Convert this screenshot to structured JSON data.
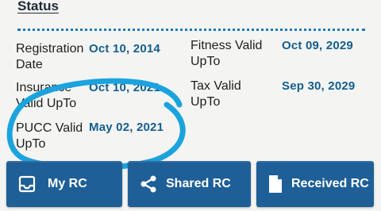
{
  "section": {
    "title": "Status"
  },
  "fields": [
    {
      "label_line1": "Registration",
      "label_line2": "Date",
      "value": "Oct 10, 2014"
    },
    {
      "label_line1": "Fitness Valid",
      "label_line2": "UpTo",
      "value": "Oct 09, 2029"
    },
    {
      "label_line1": "Insurance",
      "label_line2": "Valid UpTo",
      "value": "Oct 10, 2021"
    },
    {
      "label_line1": "Tax Valid",
      "label_line2": "UpTo",
      "value": "Sep 30, 2029"
    },
    {
      "label_line1": "PUCC Valid",
      "label_line2": "UpTo",
      "value": "May 02, 2021"
    }
  ],
  "buttons": [
    {
      "label": "My RC",
      "icon": "inbox-icon"
    },
    {
      "label": "Shared RC",
      "icon": "share-icon"
    },
    {
      "label": "Received RC",
      "icon": "document-icon"
    }
  ],
  "colors": {
    "accent": "#1f5f97",
    "value_text": "#135e90",
    "highlight": "#1ba3de"
  }
}
